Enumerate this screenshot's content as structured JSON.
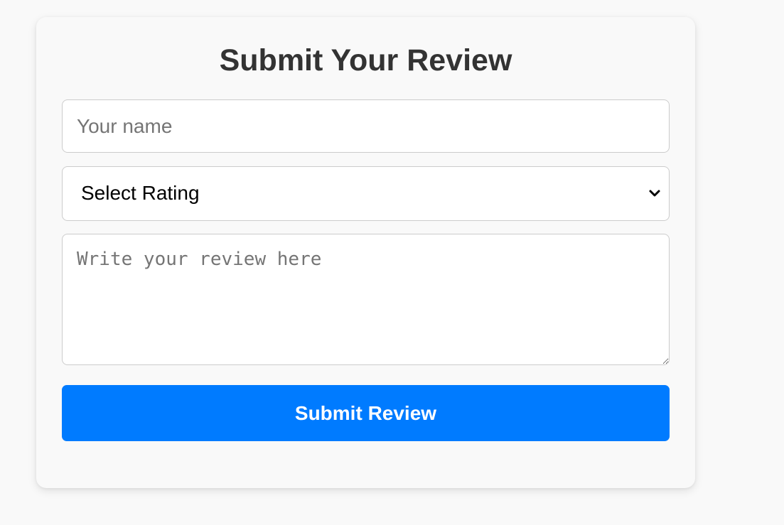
{
  "form": {
    "title": "Submit Your Review",
    "name_placeholder": "Your name",
    "rating": {
      "selected": "Select Rating",
      "icon": "chevron-down-icon"
    },
    "review_placeholder": "Write your review here",
    "submit_label": "Submit Review"
  },
  "colors": {
    "background": "#f9f9f9",
    "title": "#333333",
    "border": "#cccccc",
    "accent": "#007bff",
    "button_text": "#ffffff"
  }
}
